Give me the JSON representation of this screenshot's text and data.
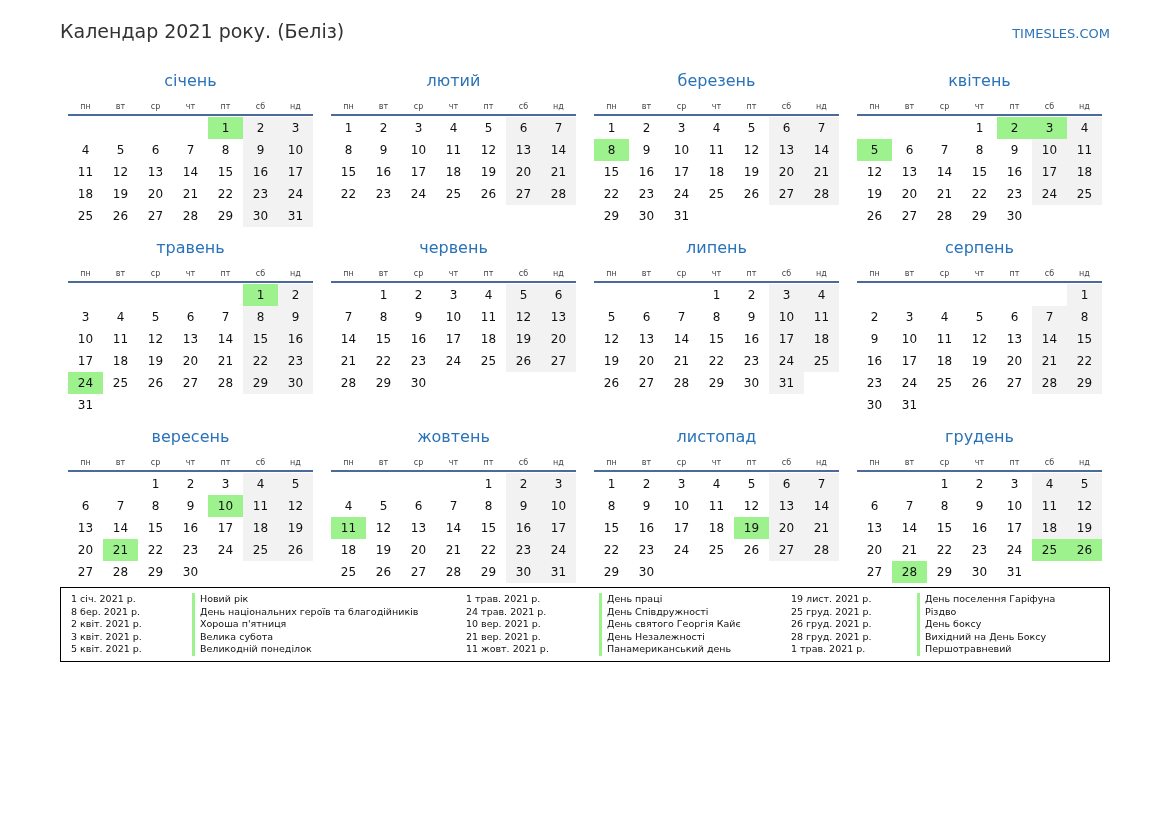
{
  "title": "Календар 2021 року. (Беліз)",
  "site": "TIMESLES.COM",
  "months": [
    {
      "name": "січень",
      "weekdays": [
        {
          "label": "пн",
          "weekend": false
        },
        {
          "label": "вт",
          "weekend": false
        },
        {
          "label": "ср",
          "weekend": false
        },
        {
          "label": "чт",
          "weekend": false
        },
        {
          "label": "пт",
          "weekend": false
        },
        {
          "label": "сб",
          "weekend": true
        },
        {
          "label": "нд",
          "weekend": true
        }
      ],
      "weeks": [
        [
          {
            "day": "1",
            "holiday": true
          },
          "2",
          "3"
        ],
        [
          "4",
          "5",
          "6",
          "7",
          "8",
          "9",
          "10"
        ],
        [
          "11",
          "12",
          "13",
          "14",
          "15",
          "16",
          "17"
        ],
        [
          "18",
          "19",
          "20",
          "21",
          "22",
          "23",
          "24"
        ],
        [
          "25",
          "26",
          "27",
          "28",
          "29",
          "30",
          "31"
        ]
      ]
    },
    {
      "name": "лютий",
      "weekdays": [
        {
          "label": "пн",
          "weekend": false
        },
        {
          "label": "вт",
          "weekend": false
        },
        {
          "label": "ср",
          "weekend": false
        },
        {
          "label": "чт",
          "weekend": false
        },
        {
          "label": "пт",
          "weekend": false
        },
        {
          "label": "сб",
          "weekend": true
        },
        {
          "label": "нд",
          "weekend": true
        }
      ],
      "weeks": [
        [
          "1",
          "2",
          "3",
          "4",
          "5",
          "6",
          "7"
        ],
        [
          "8",
          "9",
          "10",
          "11",
          "12",
          "13",
          "14"
        ],
        [
          "15",
          "16",
          "17",
          "18",
          "19",
          "20",
          "21"
        ],
        [
          "22",
          "23",
          "24",
          "25",
          "26",
          "27",
          "28"
        ]
      ]
    },
    {
      "name": "березень",
      "weekdays": [
        {
          "label": "пн",
          "weekend": false
        },
        {
          "label": "вт",
          "weekend": false
        },
        {
          "label": "ср",
          "weekend": false
        },
        {
          "label": "чт",
          "weekend": false
        },
        {
          "label": "пт",
          "weekend": false
        },
        {
          "label": "сб",
          "weekend": true
        },
        {
          "label": "нд",
          "weekend": true
        }
      ],
      "weeks": [
        [
          "1",
          "2",
          "3",
          "4",
          "5",
          "6",
          "7"
        ],
        [
          {
            "day": "8",
            "holiday": true
          },
          "9",
          "10",
          "11",
          "12",
          "13",
          "14"
        ],
        [
          "15",
          "16",
          "17",
          "18",
          "19",
          "20",
          "21"
        ],
        [
          "22",
          "23",
          "24",
          "25",
          "26",
          "27",
          "28"
        ],
        [
          "29",
          "30",
          "31"
        ]
      ]
    },
    {
      "name": "квітень",
      "weekdays": [
        {
          "label": "пн",
          "weekend": false
        },
        {
          "label": "вт",
          "weekend": false
        },
        {
          "label": "ср",
          "weekend": false
        },
        {
          "label": "чт",
          "weekend": false
        },
        {
          "label": "пт",
          "weekend": false
        },
        {
          "label": "сб",
          "weekend": true
        },
        {
          "label": "нд",
          "weekend": true
        }
      ],
      "weeks": [
        [
          "1",
          {
            "day": "2",
            "holiday": true
          },
          {
            "day": "3",
            "holiday": true
          },
          "4"
        ],
        [
          {
            "day": "5",
            "holiday": true
          },
          "6",
          "7",
          "8",
          "9",
          "10",
          "11"
        ],
        [
          "12",
          "13",
          "14",
          "15",
          "16",
          "17",
          "18"
        ],
        [
          "19",
          "20",
          "21",
          "22",
          "23",
          "24",
          "25"
        ],
        [
          "26",
          "27",
          "28",
          "29",
          "30"
        ]
      ]
    },
    {
      "name": "травень",
      "weekdays": [
        {
          "label": "пн",
          "weekend": false
        },
        {
          "label": "вт",
          "weekend": false
        },
        {
          "label": "ср",
          "weekend": false
        },
        {
          "label": "чт",
          "weekend": false
        },
        {
          "label": "пт",
          "weekend": false
        },
        {
          "label": "сб",
          "weekend": true
        },
        {
          "label": "нд",
          "weekend": true
        }
      ],
      "weeks": [
        [
          {
            "day": "1",
            "holiday": true
          },
          "2"
        ],
        [
          "3",
          "4",
          "5",
          "6",
          "7",
          "8",
          "9"
        ],
        [
          "10",
          "11",
          "12",
          "13",
          "14",
          "15",
          "16"
        ],
        [
          "17",
          "18",
          "19",
          "20",
          "21",
          "22",
          "23"
        ],
        [
          {
            "day": "24",
            "holiday": true
          },
          "25",
          "26",
          "27",
          "28",
          "29",
          "30"
        ],
        [
          "31"
        ]
      ]
    },
    {
      "name": "червень",
      "weekdays": [
        {
          "label": "пн",
          "weekend": false
        },
        {
          "label": "вт",
          "weekend": false
        },
        {
          "label": "ср",
          "weekend": false
        },
        {
          "label": "чт",
          "weekend": false
        },
        {
          "label": "пт",
          "weekend": false
        },
        {
          "label": "сб",
          "weekend": true
        },
        {
          "label": "нд",
          "weekend": true
        }
      ],
      "weeks": [
        [
          "1",
          "2",
          "3",
          "4",
          "5",
          "6"
        ],
        [
          "7",
          "8",
          "9",
          "10",
          "11",
          "12",
          "13"
        ],
        [
          "14",
          "15",
          "16",
          "17",
          "18",
          "19",
          "20"
        ],
        [
          "21",
          "22",
          "23",
          "24",
          "25",
          "26",
          "27"
        ],
        [
          "28",
          "29",
          "30"
        ]
      ]
    },
    {
      "name": "липень",
      "weekdays": [
        {
          "label": "пн",
          "weekend": false
        },
        {
          "label": "вт",
          "weekend": false
        },
        {
          "label": "ср",
          "weekend": false
        },
        {
          "label": "чт",
          "weekend": false
        },
        {
          "label": "пт",
          "weekend": false
        },
        {
          "label": "сб",
          "weekend": true
        },
        {
          "label": "нд",
          "weekend": true
        }
      ],
      "weeks": [
        [
          "1",
          "2",
          "3",
          "4"
        ],
        [
          "5",
          "6",
          "7",
          "8",
          "9",
          "10",
          "11"
        ],
        [
          "12",
          "13",
          "14",
          "15",
          "16",
          "17",
          "18"
        ],
        [
          "19",
          "20",
          "21",
          "22",
          "23",
          "24",
          "25"
        ],
        [
          "26",
          "27",
          "28",
          "29",
          "30",
          "31"
        ]
      ]
    },
    {
      "name": "серпень",
      "weekdays": [
        {
          "label": "пн",
          "weekend": false
        },
        {
          "label": "вт",
          "weekend": false
        },
        {
          "label": "ср",
          "weekend": false
        },
        {
          "label": "чт",
          "weekend": false
        },
        {
          "label": "пт",
          "weekend": false
        },
        {
          "label": "сб",
          "weekend": true
        },
        {
          "label": "нд",
          "weekend": true
        }
      ],
      "weeks": [
        [
          "1"
        ],
        [
          "2",
          "3",
          "4",
          "5",
          "6",
          "7",
          "8"
        ],
        [
          "9",
          "10",
          "11",
          "12",
          "13",
          "14",
          "15"
        ],
        [
          "16",
          "17",
          "18",
          "19",
          "20",
          "21",
          "22"
        ],
        [
          "23",
          "24",
          "25",
          "26",
          "27",
          "28",
          "29"
        ],
        [
          "30",
          "31"
        ]
      ]
    },
    {
      "name": "вересень",
      "weekdays": [
        {
          "label": "пн",
          "weekend": false
        },
        {
          "label": "вт",
          "weekend": false
        },
        {
          "label": "ср",
          "weekend": false
        },
        {
          "label": "чт",
          "weekend": false
        },
        {
          "label": "пт",
          "weekend": false
        },
        {
          "label": "сб",
          "weekend": true
        },
        {
          "label": "нд",
          "weekend": true
        }
      ],
      "weeks": [
        [
          "1",
          "2",
          "3",
          "4",
          "5"
        ],
        [
          "6",
          "7",
          "8",
          "9",
          {
            "day": "10",
            "holiday": true
          },
          "11",
          "12"
        ],
        [
          "13",
          "14",
          "15",
          "16",
          "17",
          "18",
          "19"
        ],
        [
          "20",
          {
            "day": "21",
            "holiday": true
          },
          "22",
          "23",
          "24",
          "25",
          "26"
        ],
        [
          "27",
          "28",
          "29",
          "30"
        ]
      ]
    },
    {
      "name": "жовтень",
      "weekdays": [
        {
          "label": "пн",
          "weekend": false
        },
        {
          "label": "вт",
          "weekend": false
        },
        {
          "label": "ср",
          "weekend": false
        },
        {
          "label": "чт",
          "weekend": false
        },
        {
          "label": "пт",
          "weekend": false
        },
        {
          "label": "сб",
          "weekend": true
        },
        {
          "label": "нд",
          "weekend": true
        }
      ],
      "weeks": [
        [
          "1",
          "2",
          "3"
        ],
        [
          "4",
          "5",
          "6",
          "7",
          "8",
          "9",
          "10"
        ],
        [
          {
            "day": "11",
            "holiday": true
          },
          "12",
          "13",
          "14",
          "15",
          "16",
          "17"
        ],
        [
          "18",
          "19",
          "20",
          "21",
          "22",
          "23",
          "24"
        ],
        [
          "25",
          "26",
          "27",
          "28",
          "29",
          "30",
          "31"
        ]
      ]
    },
    {
      "name": "листопад",
      "weekdays": [
        {
          "label": "пн",
          "weekend": false
        },
        {
          "label": "вт",
          "weekend": false
        },
        {
          "label": "ср",
          "weekend": false
        },
        {
          "label": "чт",
          "weekend": false
        },
        {
          "label": "пт",
          "weekend": false
        },
        {
          "label": "сб",
          "weekend": true
        },
        {
          "label": "нд",
          "weekend": true
        }
      ],
      "weeks": [
        [
          "1",
          "2",
          "3",
          "4",
          "5",
          "6",
          "7"
        ],
        [
          "8",
          "9",
          "10",
          "11",
          "12",
          "13",
          "14"
        ],
        [
          "15",
          "16",
          "17",
          "18",
          {
            "day": "19",
            "holiday": true
          },
          "20",
          "21"
        ],
        [
          "22",
          "23",
          "24",
          "25",
          "26",
          "27",
          "28"
        ],
        [
          "29",
          "30"
        ]
      ]
    },
    {
      "name": "грудень",
      "weekdays": [
        {
          "label": "пн",
          "weekend": false
        },
        {
          "label": "вт",
          "weekend": false
        },
        {
          "label": "ср",
          "weekend": false
        },
        {
          "label": "чт",
          "weekend": false
        },
        {
          "label": "пт",
          "weekend": false
        },
        {
          "label": "сб",
          "weekend": true
        },
        {
          "label": "нд",
          "weekend": true
        }
      ],
      "weeks": [
        [
          "1",
          "2",
          "3",
          "4",
          "5"
        ],
        [
          "6",
          "7",
          "8",
          "9",
          "10",
          "11",
          "12"
        ],
        [
          "13",
          "14",
          "15",
          "16",
          "17",
          "18",
          "19"
        ],
        [
          "20",
          "21",
          "22",
          "23",
          "24",
          {
            "day": "25",
            "holiday": true
          },
          {
            "day": "26",
            "holiday": true
          }
        ],
        [
          "27",
          {
            "day": "28",
            "holiday": true
          },
          "29",
          "30",
          "31"
        ]
      ]
    }
  ],
  "holidays": [
    {
      "date": "1 січ. 2021 р.",
      "name": "Новий рік"
    },
    {
      "date": "8 бер. 2021 р.",
      "name": "День національних героїв та благодійників"
    },
    {
      "date": "2 квіт. 2021 р.",
      "name": "Хороша п'ятниця"
    },
    {
      "date": "3 квіт. 2021 р.",
      "name": "Велика субота"
    },
    {
      "date": "5 квіт. 2021 р.",
      "name": "Великодній понеділок"
    },
    {
      "date": "1 трав. 2021 р.",
      "name": "День праці"
    },
    {
      "date": "24 трав. 2021 р.",
      "name": "День Співдружності"
    },
    {
      "date": "10 вер. 2021 р.",
      "name": "День святого Георгія Кайє"
    },
    {
      "date": "21 вер. 2021 р.",
      "name": "День Незалежності"
    },
    {
      "date": "11 жовт. 2021 р.",
      "name": "Панамериканський день"
    },
    {
      "date": "19 лист. 2021 р.",
      "name": "День поселення Гаріфуна"
    },
    {
      "date": "25 груд. 2021 р.",
      "name": "Різдво"
    },
    {
      "date": "26 груд. 2021 р.",
      "name": "День боксу"
    },
    {
      "date": "28 груд. 2021 р.",
      "name": "Вихідний на День Боксу"
    },
    {
      "date": "1 трав. 2021 р.",
      "name": "Першотравневий"
    }
  ]
}
